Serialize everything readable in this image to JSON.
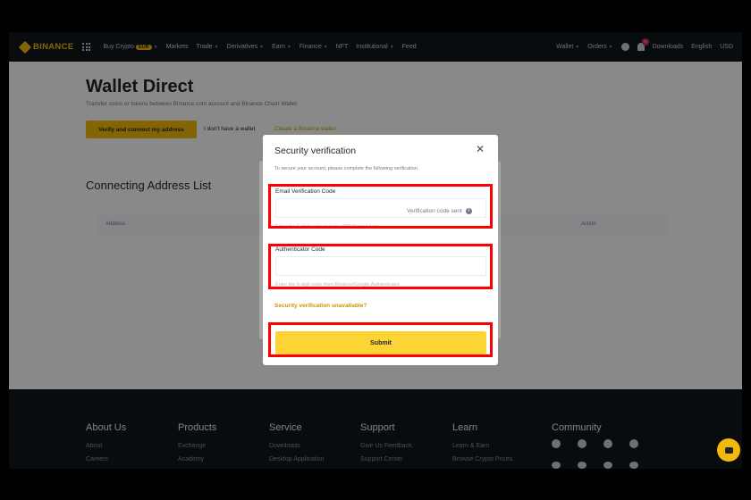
{
  "nav": {
    "logo": "BINANCE",
    "items": [
      {
        "label": "Buy Crypto",
        "badge": "EUR",
        "caret": true
      },
      {
        "label": "Markets",
        "caret": false
      },
      {
        "label": "Trade",
        "caret": true
      },
      {
        "label": "Derivatives",
        "caret": true
      },
      {
        "label": "Earn",
        "caret": true
      },
      {
        "label": "Finance",
        "caret": true
      },
      {
        "label": "NFT",
        "caret": false
      },
      {
        "label": "Institutional",
        "caret": true
      },
      {
        "label": "Feed",
        "caret": false
      }
    ],
    "wallet": "Wallet",
    "orders": "Orders",
    "notif_count": "9",
    "downloads": "Downloads",
    "language": "English",
    "currency": "USD"
  },
  "page": {
    "title": "Wallet Direct",
    "subtitle": "Transfer coins or tokens between Binance.com account and Binance Chain Wallet",
    "connect_button": "Verify and connect my address",
    "no_wallet_text": "I don't have a wallet",
    "create_link": "Create a Binance wallet",
    "list_title": "Connecting Address List",
    "col_address": "Address",
    "col_action": "Action"
  },
  "modal": {
    "title": "Security verification",
    "close": "✕",
    "description": "To secure your account, please complete the following verification.",
    "email_label": "Email Verification Code",
    "email_value": "",
    "code_sent": "Verification code sent",
    "info": "i",
    "email_hint": "Enter the 6-digit code sent to ad***@gmail.com",
    "auth_label": "Authenticator Code",
    "auth_value": "",
    "auth_hint": "Enter the 6-digit code from Binance/Google Authenticator",
    "unavailable_link": "Security verification unavailable?",
    "submit": "Submit"
  },
  "footer": {
    "about": {
      "title": "About Us",
      "links": [
        "About",
        "Careers"
      ]
    },
    "products": {
      "title": "Products",
      "links": [
        "Exchange",
        "Academy"
      ]
    },
    "service": {
      "title": "Service",
      "links": [
        "Downloads",
        "Desktop Application"
      ]
    },
    "support": {
      "title": "Support",
      "links": [
        "Give Us Feedback",
        "Support Center"
      ]
    },
    "learn": {
      "title": "Learn",
      "links": [
        "Learn & Earn",
        "Browse Crypto Prices"
      ]
    },
    "community": {
      "title": "Community"
    }
  },
  "colors": {
    "accent": "#f0b90b",
    "highlight": "#ff0000",
    "link": "#c99400"
  }
}
